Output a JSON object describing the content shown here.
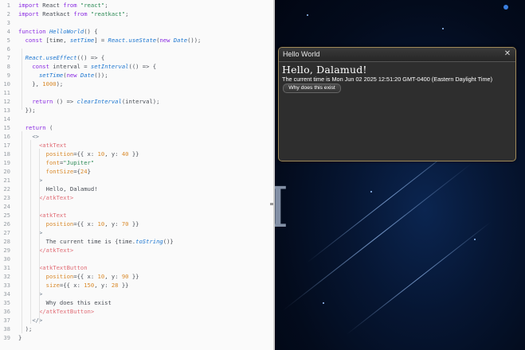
{
  "editor": {
    "line_numbers": [
      "1",
      "2",
      "3",
      "4",
      "5",
      "6",
      "7",
      "8",
      "9",
      "10",
      "11",
      "12",
      "13",
      "14",
      "15",
      "16",
      "17",
      "18",
      "19",
      "20",
      "21",
      "22",
      "23",
      "24",
      "25",
      "26",
      "27",
      "28",
      "29",
      "30",
      "31",
      "32",
      "33",
      "34",
      "35",
      "36",
      "37",
      "38",
      "39"
    ],
    "lines": [
      [
        [
          "k",
          "import"
        ],
        [
          "c",
          " React "
        ],
        [
          "k",
          "from"
        ],
        [
          "s",
          " \"react\""
        ],
        [
          "c",
          ";"
        ]
      ],
      [
        [
          "k",
          "import"
        ],
        [
          "c",
          " Reatkact "
        ],
        [
          "k",
          "from"
        ],
        [
          "s",
          " \"reatkact\""
        ],
        [
          "c",
          ";"
        ]
      ],
      [],
      [
        [
          "k",
          "function"
        ],
        [
          "c",
          " "
        ],
        [
          "f",
          "HelloWorld"
        ],
        [
          "c",
          "() {"
        ]
      ],
      [
        [
          "c",
          "  "
        ],
        [
          "k",
          "const"
        ],
        [
          "c",
          " [time, "
        ],
        [
          "f",
          "setTime"
        ],
        [
          "c",
          "] = "
        ],
        [
          "f",
          "React.useState"
        ],
        [
          "c",
          "("
        ],
        [
          "k",
          "new"
        ],
        [
          "c",
          " "
        ],
        [
          "f",
          "Date"
        ],
        [
          "c",
          "());"
        ]
      ],
      [],
      [
        [
          "c",
          "  "
        ],
        [
          "f",
          "React.useEffect"
        ],
        [
          "c",
          "(() => {"
        ]
      ],
      [
        [
          "c",
          "    "
        ],
        [
          "k",
          "const"
        ],
        [
          "c",
          " interval = "
        ],
        [
          "f",
          "setInterval"
        ],
        [
          "c",
          "(() => {"
        ]
      ],
      [
        [
          "c",
          "      "
        ],
        [
          "f",
          "setTime"
        ],
        [
          "c",
          "("
        ],
        [
          "k",
          "new"
        ],
        [
          "c",
          " "
        ],
        [
          "f",
          "Date"
        ],
        [
          "c",
          "());"
        ]
      ],
      [
        [
          "c",
          "    }, "
        ],
        [
          "n",
          "1000"
        ],
        [
          "c",
          ");"
        ]
      ],
      [],
      [
        [
          "c",
          "    "
        ],
        [
          "k",
          "return"
        ],
        [
          "c",
          " () => "
        ],
        [
          "f",
          "clearInterval"
        ],
        [
          "c",
          "(interval);"
        ]
      ],
      [
        [
          "c",
          "  });"
        ]
      ],
      [],
      [
        [
          "c",
          "  "
        ],
        [
          "k",
          "return"
        ],
        [
          "c",
          " ("
        ]
      ],
      [
        [
          "c",
          "    "
        ],
        [
          "p",
          "<>"
        ]
      ],
      [
        [
          "c",
          "      "
        ],
        [
          "t",
          "<atkText"
        ]
      ],
      [
        [
          "c",
          "        "
        ],
        [
          "n",
          "position"
        ],
        [
          "c",
          "={{ x: "
        ],
        [
          "n",
          "10"
        ],
        [
          "c",
          ", y: "
        ],
        [
          "n",
          "40"
        ],
        [
          "c",
          " }}"
        ]
      ],
      [
        [
          "c",
          "        "
        ],
        [
          "n",
          "font"
        ],
        [
          "c",
          "="
        ],
        [
          "s",
          "\"Jupiter\""
        ]
      ],
      [
        [
          "c",
          "        "
        ],
        [
          "n",
          "fontSize"
        ],
        [
          "c",
          "={"
        ],
        [
          "n",
          "24"
        ],
        [
          "c",
          "}"
        ]
      ],
      [
        [
          "c",
          "      "
        ],
        [
          "p",
          ">"
        ]
      ],
      [
        [
          "c",
          "        Hello, Dalamud!"
        ]
      ],
      [
        [
          "c",
          "      "
        ],
        [
          "t",
          "</atkText>"
        ]
      ],
      [],
      [
        [
          "c",
          "      "
        ],
        [
          "t",
          "<atkText"
        ]
      ],
      [
        [
          "c",
          "        "
        ],
        [
          "n",
          "position"
        ],
        [
          "c",
          "={{ x: "
        ],
        [
          "n",
          "10"
        ],
        [
          "c",
          ", y: "
        ],
        [
          "n",
          "70"
        ],
        [
          "c",
          " }}"
        ]
      ],
      [
        [
          "c",
          "      "
        ],
        [
          "p",
          ">"
        ]
      ],
      [
        [
          "c",
          "        The current time is {time."
        ],
        [
          "f",
          "toString"
        ],
        [
          "c",
          "()}"
        ]
      ],
      [
        [
          "c",
          "      "
        ],
        [
          "t",
          "</atkText>"
        ]
      ],
      [],
      [
        [
          "c",
          "      "
        ],
        [
          "t",
          "<atkTextButton"
        ]
      ],
      [
        [
          "c",
          "        "
        ],
        [
          "n",
          "position"
        ],
        [
          "c",
          "={{ x: "
        ],
        [
          "n",
          "10"
        ],
        [
          "c",
          ", y: "
        ],
        [
          "n",
          "90"
        ],
        [
          "c",
          " }}"
        ]
      ],
      [
        [
          "c",
          "        "
        ],
        [
          "n",
          "size"
        ],
        [
          "c",
          "={{ x: "
        ],
        [
          "n",
          "150"
        ],
        [
          "c",
          ", y: "
        ],
        [
          "n",
          "28"
        ],
        [
          "c",
          " }}"
        ]
      ],
      [
        [
          "c",
          "      "
        ],
        [
          "p",
          ">"
        ]
      ],
      [
        [
          "c",
          "        Why does this exist"
        ]
      ],
      [
        [
          "c",
          "      "
        ],
        [
          "t",
          "</atkTextButton>"
        ]
      ],
      [
        [
          "c",
          "    "
        ],
        [
          "p",
          "</>"
        ]
      ],
      [
        [
          "c",
          "  );"
        ]
      ],
      [
        [
          "c",
          "}"
        ]
      ]
    ]
  },
  "window": {
    "title": "Hello World",
    "close_glyph": "✕",
    "hello_text": "Hello, Dalamud!",
    "time_text": "The current time is Mon Jun 02 2025 12:51:20 GMT-0400 (Eastern Daylight Time)",
    "button_label": "Why does this exist"
  },
  "background": {
    "letter": "I",
    "colors": {
      "editor_bg": "#fafafa",
      "game_bg": "#061633",
      "window_bg": "#2e2e2e",
      "window_border": "#a08a5a"
    }
  }
}
